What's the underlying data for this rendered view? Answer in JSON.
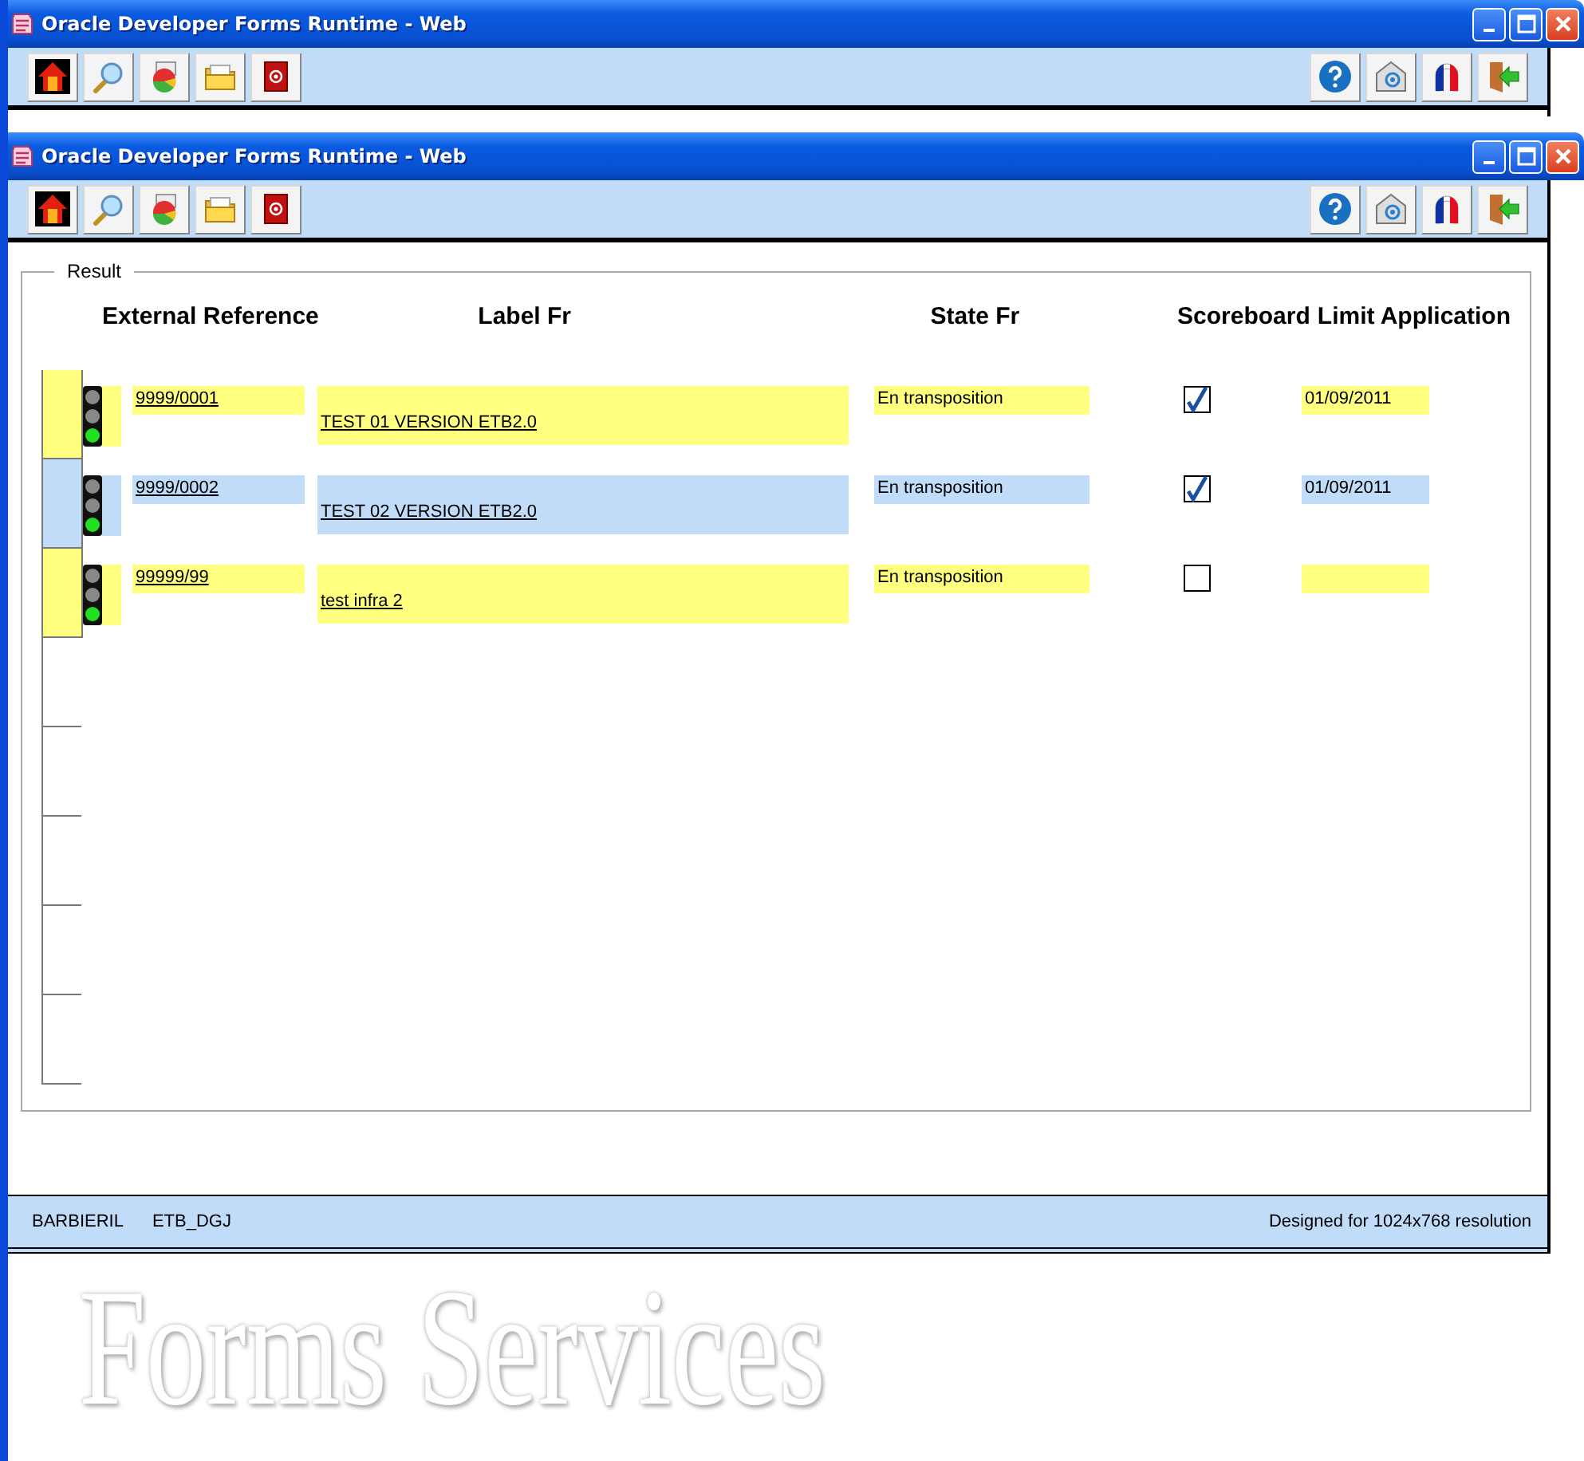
{
  "windows": [
    {
      "title": "Oracle Developer Forms Runtime - Web",
      "background_logo": "Forms Services"
    },
    {
      "title": "Oracle Developer Forms Runtime - Web",
      "result": {
        "title": "Result",
        "columns": [
          "External Reference",
          "Label Fr",
          "State Fr",
          "Scoreboard",
          "Limit Application"
        ],
        "rows": [
          {
            "kind": "record",
            "selected": false,
            "external_reference": "9999/0001",
            "label": "TEST 01  VERSION ETB2.0",
            "state": "En transposition",
            "scoreboard": true,
            "limit_application": "01/09/2011"
          },
          {
            "kind": "record",
            "selected": true,
            "external_reference": "9999/0002",
            "label": "TEST 02 VERSION ETB2.0",
            "state": "En transposition",
            "scoreboard": true,
            "limit_application": "01/09/2011"
          },
          {
            "kind": "record",
            "selected": false,
            "external_reference": "99999/99",
            "label": "test infra 2",
            "state": "En transposition",
            "scoreboard": false
          },
          {
            "kind": "blank"
          },
          {
            "kind": "blank"
          },
          {
            "kind": "blank"
          },
          {
            "kind": "blank"
          },
          {
            "kind": "blank"
          }
        ]
      },
      "status_bar": {
        "user": "BARBIERIL",
        "database": "ETB_DGJ",
        "note": "Designed for 1024x768 resolution"
      }
    }
  ]
}
